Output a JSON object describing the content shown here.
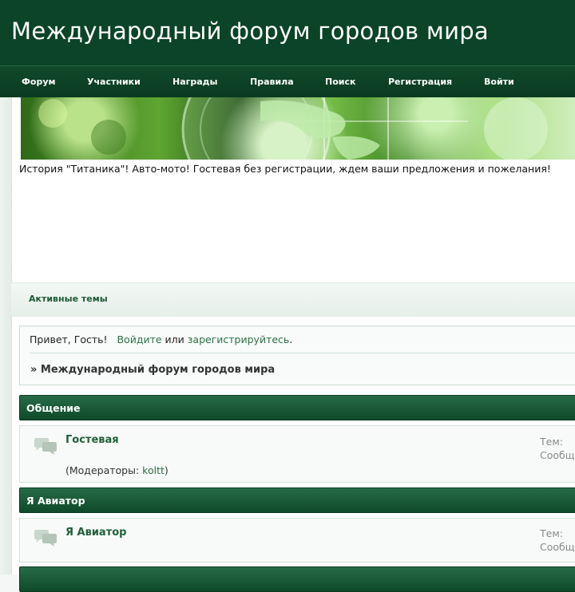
{
  "header": {
    "title": "Международный форум городов мира"
  },
  "nav": {
    "items": [
      {
        "label": "Форум"
      },
      {
        "label": "Участники"
      },
      {
        "label": "Награды"
      },
      {
        "label": "Правила"
      },
      {
        "label": "Поиск"
      },
      {
        "label": "Регистрация"
      },
      {
        "label": "Войти"
      }
    ]
  },
  "announcement": {
    "text": "История \"Титаника\"! Авто-мото! Гостевая без регистрации, ждем ваши предложения и пожелания!"
  },
  "active_topics": {
    "label": "Активные темы"
  },
  "welcome": {
    "greeting": "Привет, Гость!",
    "login_link": "Войдите",
    "or": "или",
    "register_link": "зарегистрируйтесь",
    "period": ".",
    "breadcrumb": "» Международный форум городов мира"
  },
  "categories": [
    {
      "title": "Общение",
      "forums": [
        {
          "name": "Гостевая",
          "moderators_prefix": "(Модераторы: ",
          "moderator": "koltt",
          "moderators_suffix": ")",
          "topics_label": "Тем:",
          "posts_label": "Сообщений:"
        }
      ]
    },
    {
      "title": "Я Авиатор",
      "forums": [
        {
          "name": "Я Авиатор",
          "topics_label": "Тем:",
          "posts_label": "Сообщений:"
        }
      ]
    }
  ],
  "icons": {
    "forum_icon": "speech-bubbles-icon"
  },
  "colors": {
    "header_bg": "#0b4427",
    "link": "#2b7045",
    "category_bg": "#1c5c3a"
  }
}
